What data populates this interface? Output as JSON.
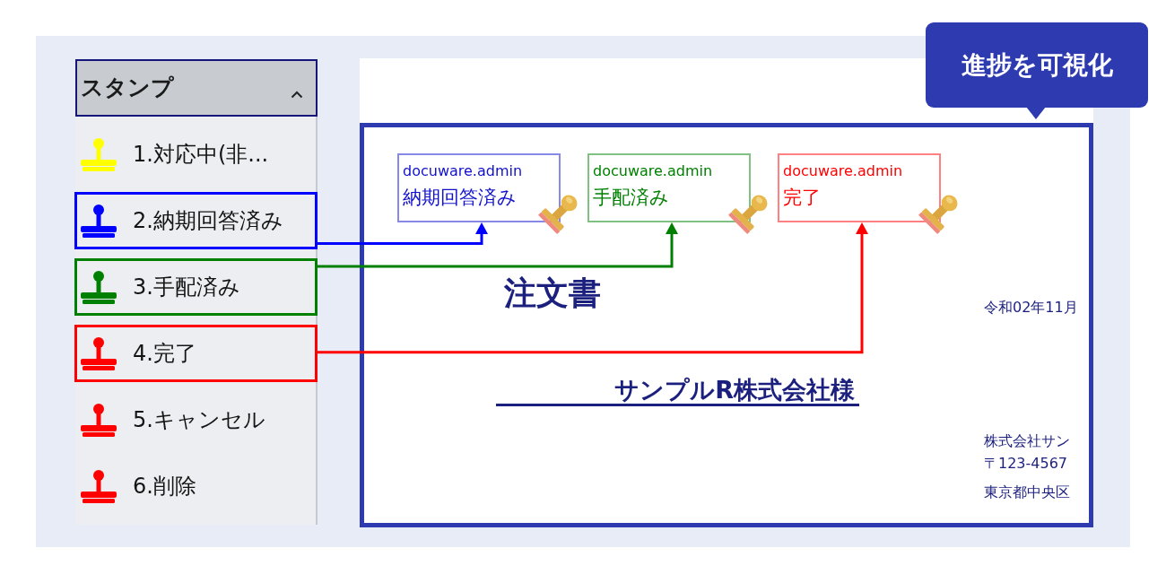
{
  "callout": {
    "text": "進捗を可視化"
  },
  "stamp_panel": {
    "title": "スタンプ",
    "expanded": true,
    "items": [
      {
        "label": "1.対応中(非...",
        "color": "#ffff00",
        "highlighted": false
      },
      {
        "label": "2.納期回答済み",
        "color": "#0000ff",
        "highlighted": true
      },
      {
        "label": "3.手配済み",
        "color": "#008000",
        "highlighted": true
      },
      {
        "label": "4.完了",
        "color": "#ff0000",
        "highlighted": true
      },
      {
        "label": "5.キャンセル",
        "color": "#ff0000",
        "highlighted": false
      },
      {
        "label": "6.削除",
        "color": "#ff0000",
        "highlighted": false
      }
    ]
  },
  "document": {
    "applied_stamps": [
      {
        "user": "docuware.admin",
        "status": "納期回答済み",
        "color": "#1010cc"
      },
      {
        "user": "docuware.admin",
        "status": "手配済み",
        "color": "#008000"
      },
      {
        "user": "docuware.admin",
        "status": "完了",
        "color": "#ff0000"
      }
    ],
    "title": "注文書",
    "date": "令和02年11月",
    "addressee": "サンプルR株式会社様",
    "sender": [
      "株式会社サン",
      "〒123-4567",
      "東京都中央区"
    ]
  }
}
